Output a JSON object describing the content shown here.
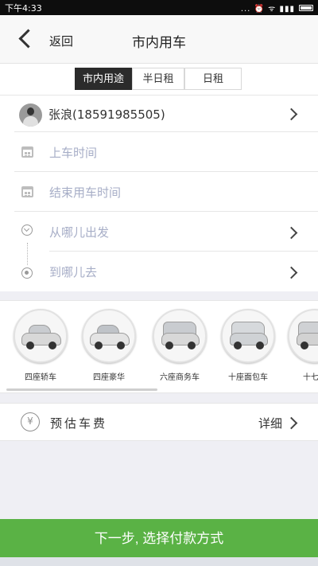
{
  "status_bar": {
    "time": "下午4:33",
    "indicators": "... ⏰ ᯤ ▮▮▮"
  },
  "navbar": {
    "back_label": "返回",
    "title": "市内用车"
  },
  "tabs": [
    {
      "label": "市内用途",
      "active": true
    },
    {
      "label": "半日租",
      "active": false
    },
    {
      "label": "日租",
      "active": false
    }
  ],
  "passenger": {
    "text": "张浪(18591985505)"
  },
  "form": {
    "start_time_placeholder": "上车时间",
    "end_time_placeholder": "结束用车时间",
    "from_placeholder": "从哪儿出发",
    "to_placeholder": "到哪儿去"
  },
  "cars": [
    {
      "label": "四座轿车"
    },
    {
      "label": "四座豪华"
    },
    {
      "label": "六座商务车"
    },
    {
      "label": "十座面包车"
    },
    {
      "label": "十七座"
    }
  ],
  "fee": {
    "icon": "¥",
    "label": "预估车费",
    "detail_label": "详细"
  },
  "next_button": "下一步, 选择付款方式",
  "colors": {
    "accent_green": "#5ab245",
    "tab_active": "#2b2b2b",
    "placeholder": "#a7aec7"
  }
}
